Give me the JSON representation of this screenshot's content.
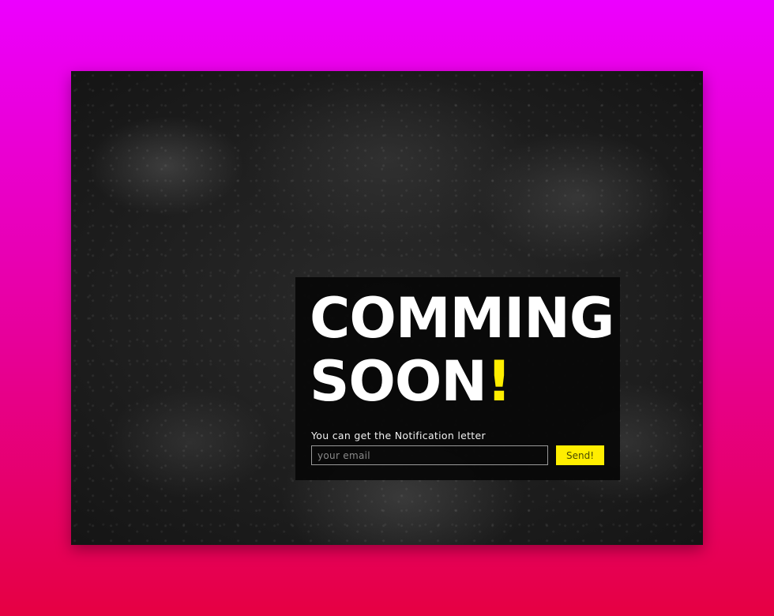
{
  "theme": {
    "accent": "#ffee00",
    "background_top": "#ec00ff",
    "background_bottom": "#e60042"
  },
  "hero": {
    "title_line1": "COMMING",
    "title_line2": "SOON",
    "title_bang": "!"
  },
  "signup": {
    "caption": "You can get the Notification letter",
    "email_placeholder": "your email",
    "email_value": "",
    "send_label": "Send!"
  }
}
